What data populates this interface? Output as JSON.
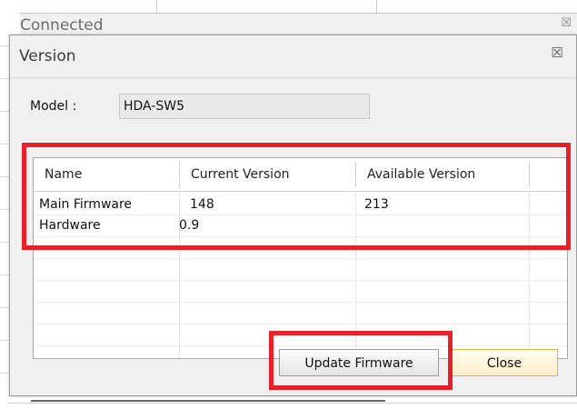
{
  "background_window": {
    "title": "Connected",
    "close_glyph": "☒"
  },
  "dialog": {
    "title": "Version",
    "close_glyph": "☒",
    "model_label": "Model :",
    "model_value": "HDA-SW5"
  },
  "table": {
    "columns": [
      "Name",
      "Current Version",
      "Available Version"
    ],
    "rows": [
      [
        "Main Firmware",
        "148",
        "213"
      ],
      [
        "Hardware",
        "0.9",
        ""
      ]
    ]
  },
  "buttons": {
    "update_label": "Update Firmware",
    "close_label": "Close"
  },
  "colors": {
    "highlight_red": "#e8202a",
    "close_button_border": "#e0b24a"
  }
}
